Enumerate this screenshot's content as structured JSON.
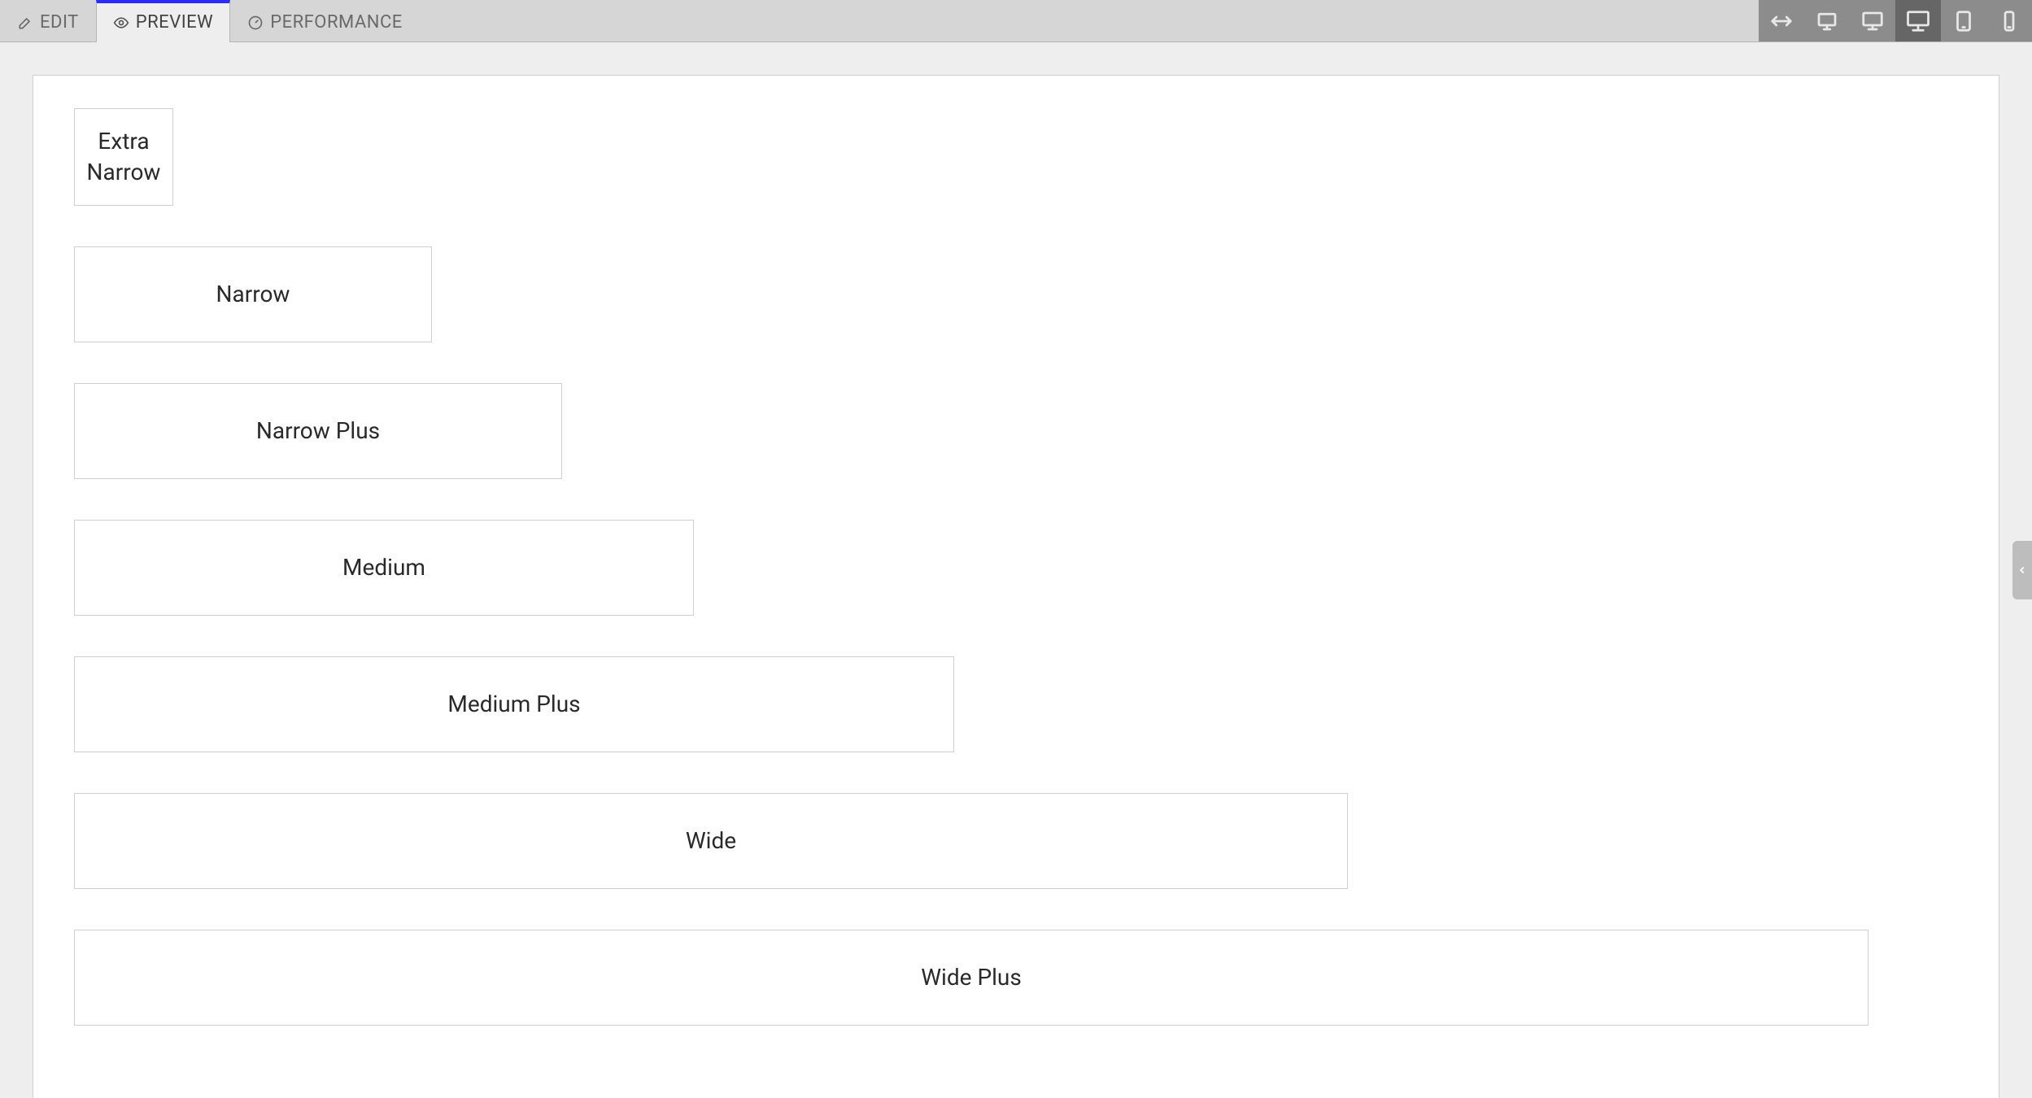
{
  "tabs": {
    "edit": "EDIT",
    "preview": "PREVIEW",
    "performance": "PERFORMANCE"
  },
  "blocks": {
    "extra_narrow": "Extra Narrow",
    "narrow": "Narrow",
    "narrow_plus": "Narrow Plus",
    "medium": "Medium",
    "medium_plus": "Medium Plus",
    "wide": "Wide",
    "wide_plus": "Wide Plus"
  }
}
